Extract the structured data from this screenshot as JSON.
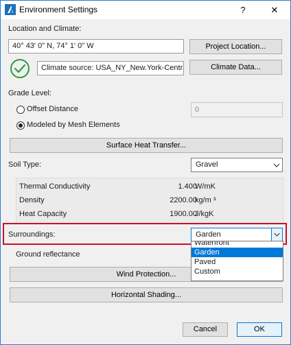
{
  "window": {
    "title": "Environment Settings",
    "help_glyph": "?",
    "close_glyph": "✕"
  },
  "location": {
    "section_label": "Location and Climate:",
    "coordinates": "40° 43' 0\" N, 74° 1' 0\" W",
    "project_location_button": "Project Location...",
    "climate_source": "Climate source: USA_NY_New.York-Central.Park",
    "climate_data_button": "Climate Data...",
    "status_icon": "check-circle-icon"
  },
  "grade": {
    "section_label": "Grade Level:",
    "offset_label": "Offset Distance",
    "offset_value": "0",
    "modeled_label": "Modeled by Mesh Elements",
    "selected": "Modeled by Mesh Elements",
    "surface_heat_button": "Surface Heat Transfer..."
  },
  "soil": {
    "label": "Soil Type:",
    "value": "Gravel",
    "properties": [
      {
        "name": "Thermal Conductivity",
        "value": "1.400",
        "unit": "W/mK"
      },
      {
        "name": "Density",
        "value": "2200.00",
        "unit": "kg/m ³"
      },
      {
        "name": "Heat Capacity",
        "value": "1900.00",
        "unit": "J/kgK"
      }
    ]
  },
  "surroundings": {
    "label": "Surroundings:",
    "value": "Garden",
    "options": [
      "Waterfront",
      "Garden",
      "Paved",
      "Custom"
    ],
    "selected_option": "Garden",
    "ground_reflectance_label": "Ground reflectance",
    "highlight_color": "#c8102e"
  },
  "buttons": {
    "wind_protection": "Wind Protection...",
    "horizontal_shading": "Horizontal Shading...",
    "cancel": "Cancel",
    "ok": "OK"
  },
  "colors": {
    "accent": "#0078d7",
    "success": "#2e9a3a"
  }
}
